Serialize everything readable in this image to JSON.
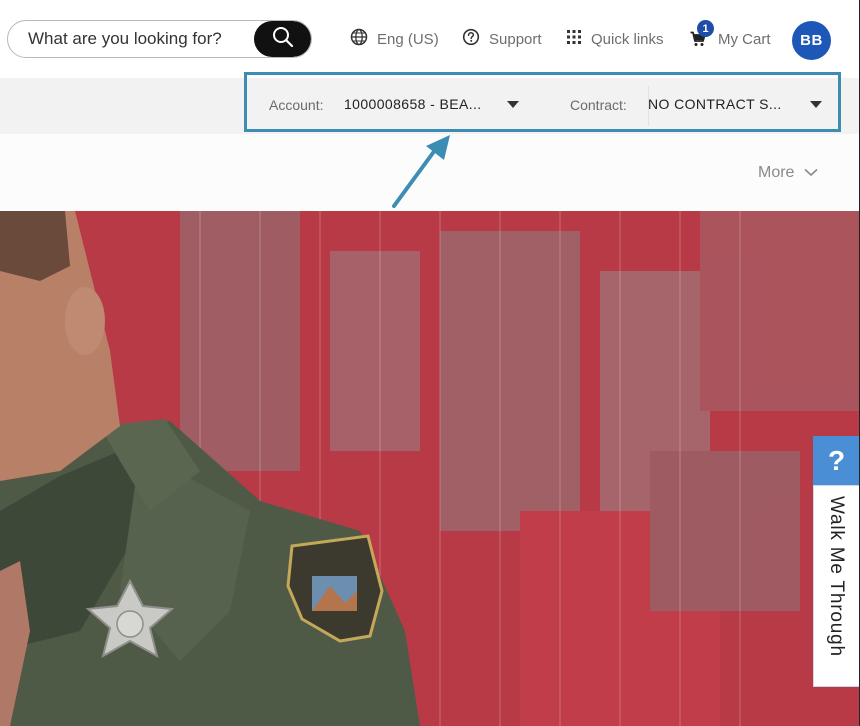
{
  "header": {
    "search": {
      "placeholder": "What are you looking for?",
      "button_icon": "search-icon"
    },
    "language": {
      "label": "Eng (US)",
      "icon": "globe-icon"
    },
    "support": {
      "label": "Support",
      "icon": "help-circle-icon"
    },
    "quick_links": {
      "label": "Quick links",
      "icon": "grid-dots-icon"
    },
    "cart": {
      "label": "My Cart",
      "count": "1",
      "icon": "cart-icon"
    },
    "user": {
      "initials": "BB"
    }
  },
  "account_bar": {
    "account_label": "Account:",
    "account_value": "1000008658 - BEA...",
    "contract_label": "Contract:",
    "contract_value": "NO CONTRACT S..."
  },
  "menu": {
    "more_label": "More"
  },
  "walkme": {
    "icon": "?",
    "label": "Walk Me Through"
  },
  "colors": {
    "brand_blue": "#1d58b8",
    "highlight": "#3d8cb3",
    "walkme_blue": "#4a8fd6",
    "search_button": "#111111"
  }
}
